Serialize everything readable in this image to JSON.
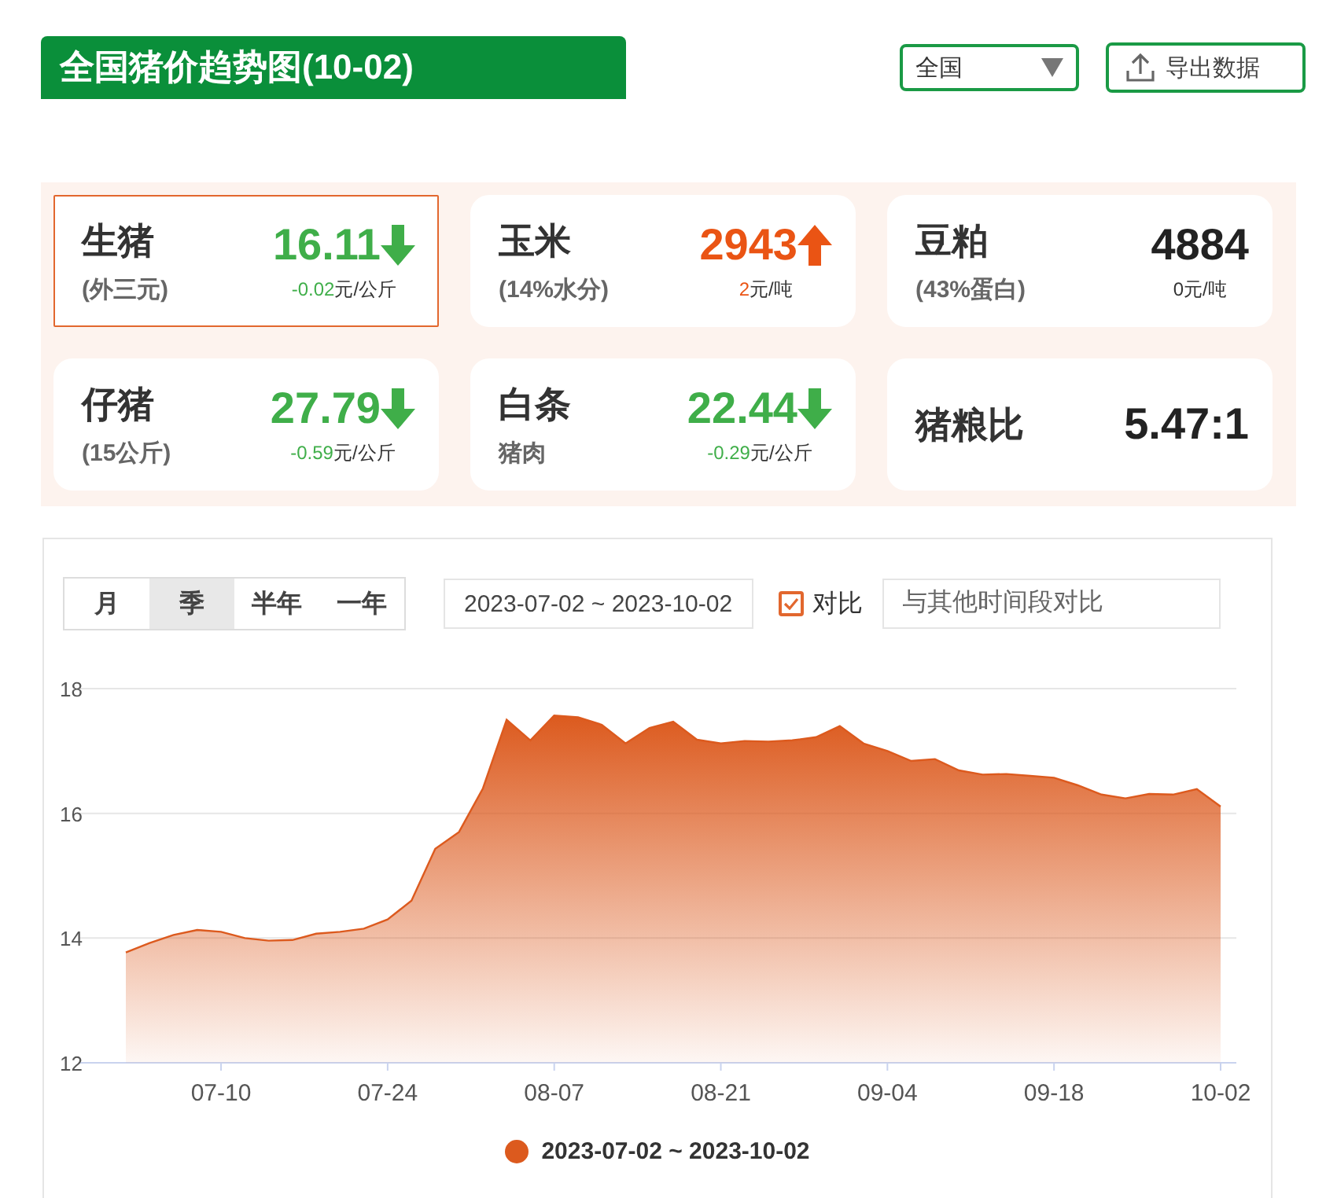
{
  "header": {
    "title": "全国猪价趋势图(10-02)",
    "region_select": {
      "value": "全国"
    },
    "export_button": "导出数据"
  },
  "cards": [
    {
      "name": "生猪",
      "sub": "(外三元)",
      "value": "16.11",
      "kind": "down",
      "change": "-0.02",
      "unit": "元/公斤",
      "selected": true
    },
    {
      "name": "玉米",
      "sub": "(14%水分)",
      "value": "2943",
      "kind": "up",
      "change": "2",
      "unit": "元/吨",
      "selected": false
    },
    {
      "name": "豆粕",
      "sub": "(43%蛋白)",
      "value": "4884",
      "kind": "flat",
      "change": "0",
      "unit": "元/吨",
      "selected": false
    },
    {
      "name": "仔猪",
      "sub": "(15公斤)",
      "value": "27.79",
      "kind": "down",
      "change": "-0.59",
      "unit": "元/公斤",
      "selected": false
    },
    {
      "name": "白条",
      "sub": "猪肉",
      "value": "22.44",
      "kind": "down",
      "change": "-0.29",
      "unit": "元/公斤",
      "selected": false
    },
    {
      "name": "猪粮比",
      "value": "5.47:1",
      "kind": "flat",
      "selected": false
    }
  ],
  "range_tabs": [
    {
      "label": "月",
      "selected": false
    },
    {
      "label": "季",
      "selected": true
    },
    {
      "label": "半年",
      "selected": false
    },
    {
      "label": "一年",
      "selected": false
    }
  ],
  "date_range": "2023-07-02 ~ 2023-10-02",
  "compare": {
    "label": "对比",
    "checked": true,
    "placeholder": "与其他时间段对比"
  },
  "chart_data": {
    "type": "area",
    "ylim": [
      12,
      18
    ],
    "yticks": [
      12,
      14,
      16,
      18
    ],
    "categories": [
      null,
      null,
      null,
      null,
      "07-10",
      null,
      null,
      null,
      null,
      null,
      null,
      "07-24",
      null,
      null,
      null,
      null,
      null,
      null,
      "08-07",
      null,
      null,
      null,
      null,
      null,
      null,
      "08-21",
      null,
      null,
      null,
      null,
      null,
      null,
      "09-04",
      null,
      null,
      null,
      null,
      null,
      null,
      "09-18",
      null,
      null,
      null,
      null,
      null,
      null,
      "10-02"
    ],
    "series": [
      {
        "name": "2023-07-02 ~ 2023-10-02",
        "color": "#dc5a1e",
        "values": [
          13.77,
          13.92,
          14.05,
          14.13,
          14.1,
          14.0,
          13.96,
          13.97,
          14.07,
          14.1,
          14.15,
          14.3,
          14.6,
          15.43,
          15.7,
          16.4,
          17.5,
          17.17,
          17.57,
          17.54,
          17.42,
          17.12,
          17.37,
          17.47,
          17.18,
          17.12,
          17.16,
          17.15,
          17.17,
          17.22,
          17.4,
          17.12,
          17.0,
          16.84,
          16.87,
          16.69,
          16.62,
          16.63,
          16.6,
          16.57,
          16.45,
          16.3,
          16.24,
          16.31,
          16.3,
          16.39,
          16.11
        ]
      }
    ]
  }
}
